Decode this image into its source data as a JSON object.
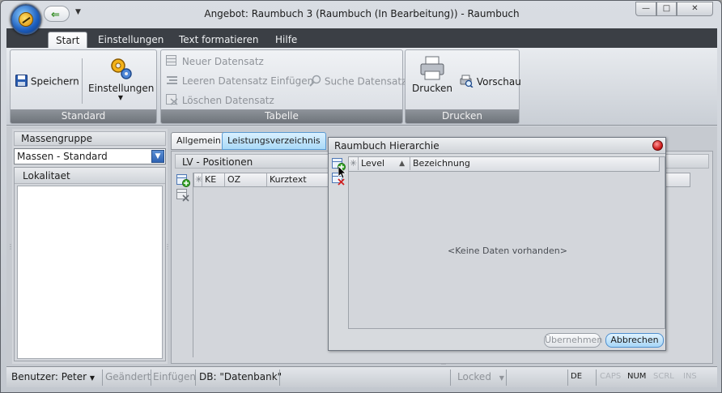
{
  "window": {
    "title": "Angebot: Raumbuch 3  (Raumbuch  (In Bearbeitung)) - Raumbuch",
    "min_glyph": "—",
    "max_glyph": "□",
    "close_glyph": "✕"
  },
  "ribbon": {
    "tabs": [
      "Start",
      "Einstellungen",
      "Text formatieren",
      "Hilfe"
    ],
    "groups": {
      "standard": {
        "label": "Standard",
        "save": "Speichern",
        "settings": "Einstellungen"
      },
      "tabelle": {
        "label": "Tabelle",
        "new_record": "Neuer Datensatz",
        "insert_empty": "Leeren Datensatz Einfügen",
        "search": "Suche Datensatz",
        "delete": "Löschen Datensatz"
      },
      "drucken": {
        "label": "Drucken",
        "print": "Drucken",
        "preview": "Vorschau"
      }
    }
  },
  "left_panel": {
    "group_title": "Massengruppe",
    "combo_value": "Massen - Standard",
    "box_title": "Lokalitaet"
  },
  "right_panel": {
    "tabs": [
      "Allgemein",
      "Leistungsverzeichnis"
    ],
    "section_title": "LV - Positionen",
    "columns": [
      "KE",
      "OZ",
      "Kurztext"
    ]
  },
  "dialog": {
    "title": "Raumbuch Hierarchie",
    "columns": [
      "Level",
      "Bezeichnung"
    ],
    "empty_text": "<Keine Daten vorhanden>",
    "accept": "Übernehmen",
    "cancel": "Abbrechen"
  },
  "statusbar": {
    "user": "Benutzer: Peter",
    "changed": "Geändert",
    "insert": "Einfügen",
    "db": "DB: \"Datenbank\"",
    "locked": "Locked",
    "lang": "DE",
    "caps": "CAPS",
    "num": "NUM",
    "scrl": "SCRL",
    "ins": "INS"
  },
  "colors": {
    "accent_tab": "#a9d9f7",
    "ribbon_tab_bar": "#3b3f45",
    "close_red": "#d01f1f"
  }
}
